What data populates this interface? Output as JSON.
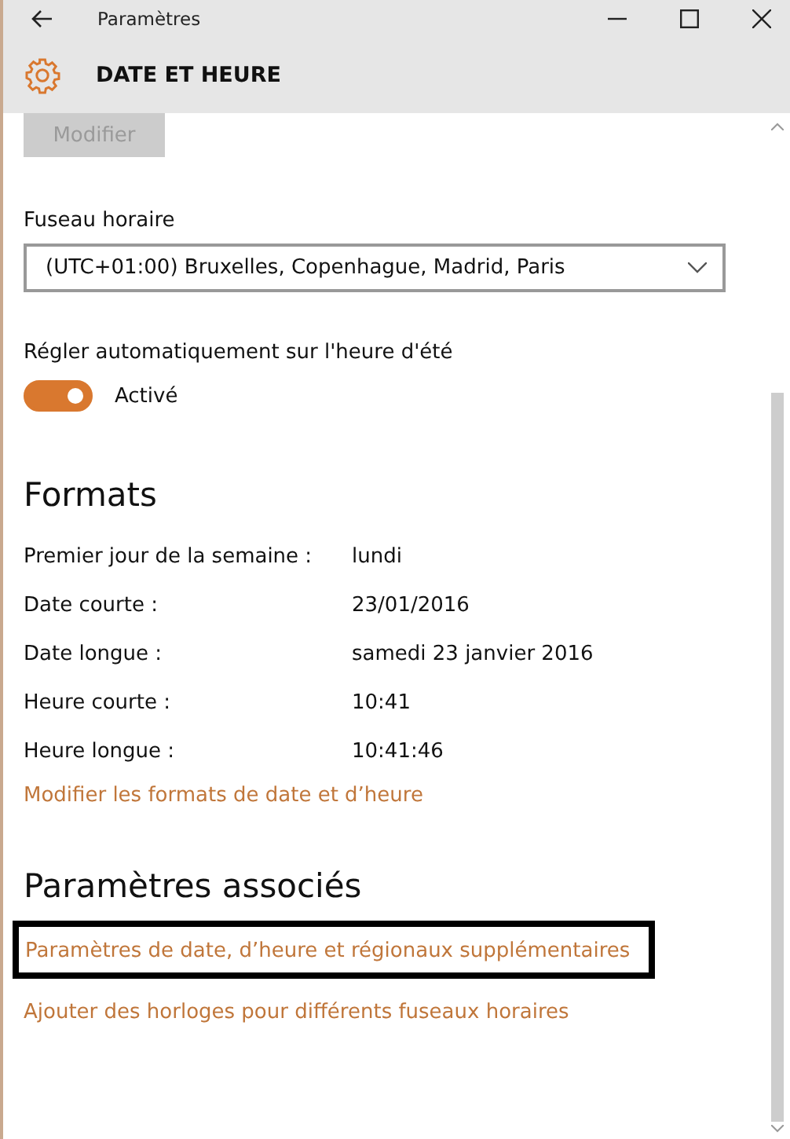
{
  "window": {
    "title": "Paramètres"
  },
  "header": {
    "title": "DATE ET HEURE"
  },
  "modify_button": {
    "label": "Modifier",
    "disabled": true
  },
  "timezone": {
    "label": "Fuseau horaire",
    "value": "(UTC+01:00) Bruxelles, Copenhague, Madrid, Paris"
  },
  "dst": {
    "label": "Régler automatiquement sur l'heure d'été",
    "on": true,
    "state_text": "Activé"
  },
  "formats": {
    "heading": "Formats",
    "rows": [
      {
        "label": "Premier jour de la semaine :",
        "value": "lundi"
      },
      {
        "label": "Date courte :",
        "value": "23/01/2016"
      },
      {
        "label": "Date longue :",
        "value": "samedi 23 janvier 2016"
      },
      {
        "label": "Heure courte :",
        "value": "10:41"
      },
      {
        "label": "Heure longue :",
        "value": "10:41:46"
      }
    ],
    "link": "Modifier les formats de date et d’heure"
  },
  "related": {
    "heading": "Paramètres associés",
    "links": [
      {
        "text": "Paramètres de date, d’heure et régionaux supplémentaires",
        "highlighted": true
      },
      {
        "text": "Ajouter des horloges pour différents fuseaux horaires",
        "highlighted": false
      }
    ]
  }
}
